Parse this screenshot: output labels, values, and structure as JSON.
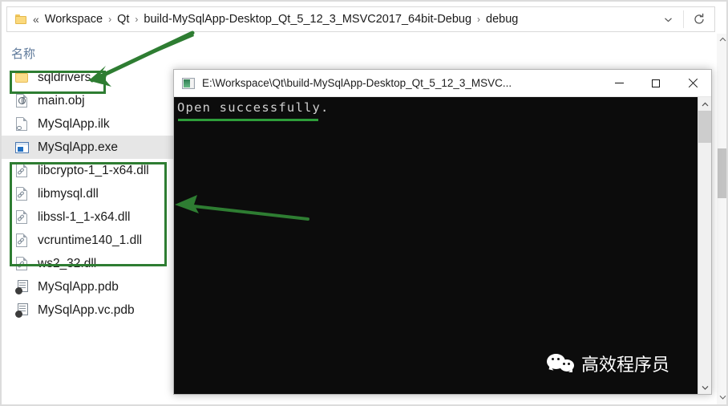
{
  "explorer": {
    "address": {
      "folder_icon": "folder-icon",
      "overflow_glyph": "«",
      "crumbs": [
        "Workspace",
        "Qt",
        "build-MySqlApp-Desktop_Qt_5_12_3_MSVC2017_64bit-Debug",
        "debug"
      ],
      "separator": "›",
      "dropdown_icon": "chevron-down-icon",
      "refresh_icon": "refresh-icon"
    },
    "column_header": "名称",
    "files": [
      {
        "name": "sqldrivers",
        "icon": "folder-icon",
        "type": "folder",
        "selected": false
      },
      {
        "name": "main.obj",
        "icon": "obj-file-icon",
        "type": "obj",
        "selected": false
      },
      {
        "name": "MySqlApp.ilk",
        "icon": "ilk-file-icon",
        "type": "ilk",
        "selected": false
      },
      {
        "name": "MySqlApp.exe",
        "icon": "exe-file-icon",
        "type": "exe",
        "selected": true
      },
      {
        "name": "libcrypto-1_1-x64.dll",
        "icon": "dll-file-icon",
        "type": "dll",
        "selected": false
      },
      {
        "name": "libmysql.dll",
        "icon": "dll-file-icon",
        "type": "dll",
        "selected": false
      },
      {
        "name": "libssl-1_1-x64.dll",
        "icon": "dll-file-icon",
        "type": "dll",
        "selected": false
      },
      {
        "name": "vcruntime140_1.dll",
        "icon": "dll-file-icon",
        "type": "dll",
        "selected": false
      },
      {
        "name": "ws2_32.dll",
        "icon": "dll-file-icon",
        "type": "dll",
        "selected": false
      },
      {
        "name": "MySqlApp.pdb",
        "icon": "pdb-file-icon",
        "type": "pdb",
        "selected": false
      },
      {
        "name": "MySqlApp.vc.pdb",
        "icon": "pdb-file-icon",
        "type": "pdb",
        "selected": false
      }
    ],
    "scrollbar": {
      "up_icon": "scroll-up-icon",
      "down_icon": "scroll-down-icon"
    }
  },
  "annotations": {
    "color": "#2e7d32",
    "highlight_boxes": [
      {
        "name": "sqldrivers-highlight",
        "target": "sqldrivers"
      },
      {
        "name": "dll-group-highlight",
        "target": "dll files"
      }
    ],
    "arrows": [
      {
        "name": "arrow-to-sqldrivers",
        "direction": "left"
      },
      {
        "name": "arrow-to-dlls",
        "direction": "left"
      }
    ]
  },
  "console": {
    "title": "E:\\Workspace\\Qt\\build-MySqlApp-Desktop_Qt_5_12_3_MSVC...",
    "icon": "console-app-icon",
    "window_buttons": {
      "minimize": "minimize-icon",
      "maximize": "maximize-icon",
      "close": "close-icon"
    },
    "output": "Open successfully.",
    "scrollbar": {
      "up_icon": "scroll-up-icon",
      "down_icon": "scroll-down-icon"
    }
  },
  "watermark": {
    "logo": "wechat-icon",
    "text": "高效程序员"
  },
  "colors": {
    "annotation_green": "#2e7d32",
    "console_bg": "#0c0c0c",
    "console_text": "#cfcfcf",
    "selection_gray": "#e6e6e6",
    "header_blue": "#5f7a9b"
  }
}
